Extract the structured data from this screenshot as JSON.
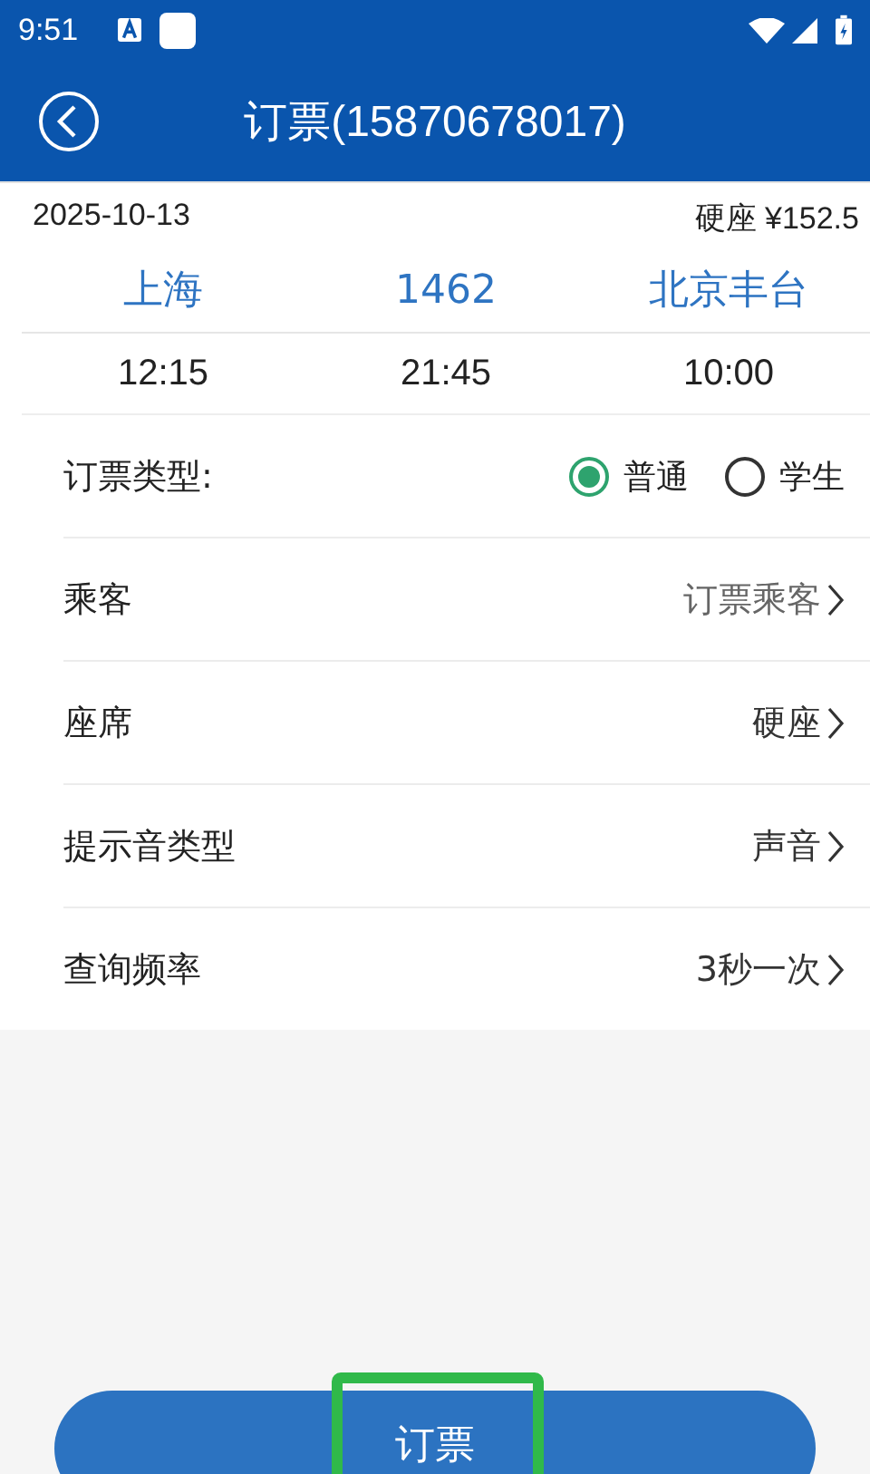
{
  "status_bar": {
    "time": "9:51"
  },
  "header": {
    "title": "订票(15870678017)"
  },
  "trip": {
    "date": "2025-10-13",
    "fare": "硬座 ¥152.5",
    "from": "上海",
    "train": "1462",
    "to": "北京丰台",
    "depart": "12:15",
    "duration": "21:45",
    "arrive": "10:00"
  },
  "ticket_type": {
    "label": "订票类型:",
    "options": [
      {
        "label": "普通",
        "selected": true
      },
      {
        "label": "学生",
        "selected": false
      }
    ]
  },
  "rows": [
    {
      "label": "乘客",
      "value": "订票乘客"
    },
    {
      "label": "座席",
      "value": "硬座"
    },
    {
      "label": "提示音类型",
      "value": "声音"
    },
    {
      "label": "查询频率",
      "value": "3秒一次"
    }
  ],
  "submit": {
    "label": "订票",
    "highlighted": true
  }
}
